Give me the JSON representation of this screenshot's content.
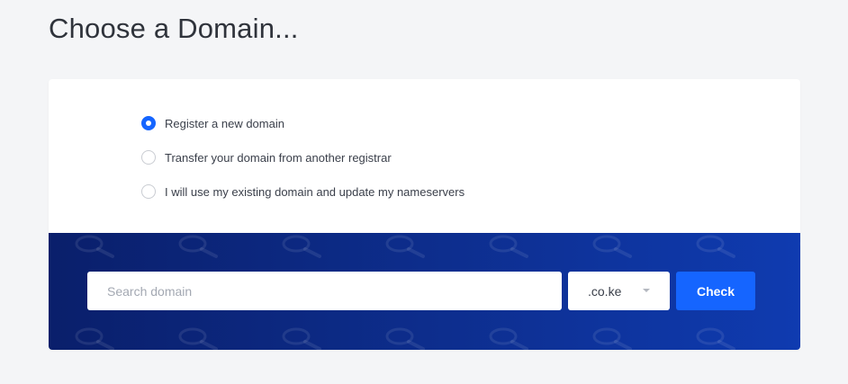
{
  "page": {
    "title": "Choose a Domain..."
  },
  "domain_options": [
    {
      "label": "Register a new domain",
      "checked": true
    },
    {
      "label": "Transfer your domain from another registrar",
      "checked": false
    },
    {
      "label": "I will use my existing domain and update my nameservers",
      "checked": false
    }
  ],
  "search": {
    "placeholder": "Search domain",
    "value": "",
    "tld_selected": ".co.ke",
    "check_label": "Check"
  },
  "colors": {
    "accent": "#1565ff",
    "band_dark": "#0a1f6b",
    "band_light": "#0f3bb0",
    "page_bg": "#f4f5f7"
  },
  "icons": {
    "band_pattern": "magnifier-icon",
    "tld_dropdown": "caret-down-icon"
  }
}
